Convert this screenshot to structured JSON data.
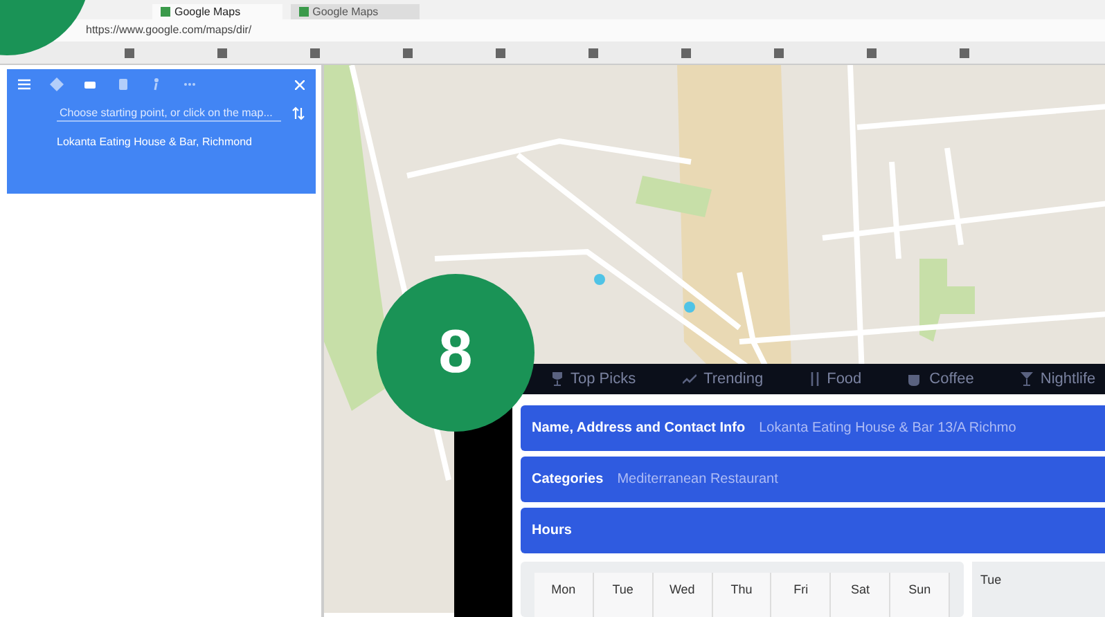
{
  "browser": {
    "tabs": [
      {
        "label": "Google Maps",
        "selected": true
      },
      {
        "label": "Google Maps",
        "selected": false
      }
    ],
    "address": "https://www.google.com/maps/dir/"
  },
  "directions": {
    "modes": [
      {
        "kind": "best",
        "selected": false
      },
      {
        "kind": "car",
        "selected": true
      },
      {
        "kind": "transit",
        "selected": false
      },
      {
        "kind": "walk",
        "selected": false
      },
      {
        "kind": "more",
        "selected": false
      }
    ],
    "start_placeholder": "Choose starting point, or click on the map...",
    "destination": "Lokanta Eating House & Bar, Richmond"
  },
  "badges": [
    {
      "kind": "partial"
    },
    {
      "kind": "full",
      "label": "8"
    }
  ],
  "overlay": {
    "nav": [
      {
        "label": "Top Picks",
        "kind": "trophy"
      },
      {
        "label": "Trending",
        "kind": "trend"
      },
      {
        "label": "Food",
        "kind": "food"
      },
      {
        "label": "Coffee",
        "kind": "cup"
      },
      {
        "label": "Nightlife",
        "kind": "glass"
      }
    ],
    "sections": [
      {
        "title": "Name, Address and Contact Info",
        "value": "Lokanta Eating House & Bar 13/A Richmo"
      },
      {
        "title": "Categories",
        "value": "Mediterranean Restaurant"
      },
      {
        "title": "Hours"
      }
    ],
    "days": [
      "Mon",
      "Tue",
      "Wed",
      "Thu",
      "Fri",
      "Sat",
      "Sun"
    ],
    "side_day": "Tue"
  }
}
